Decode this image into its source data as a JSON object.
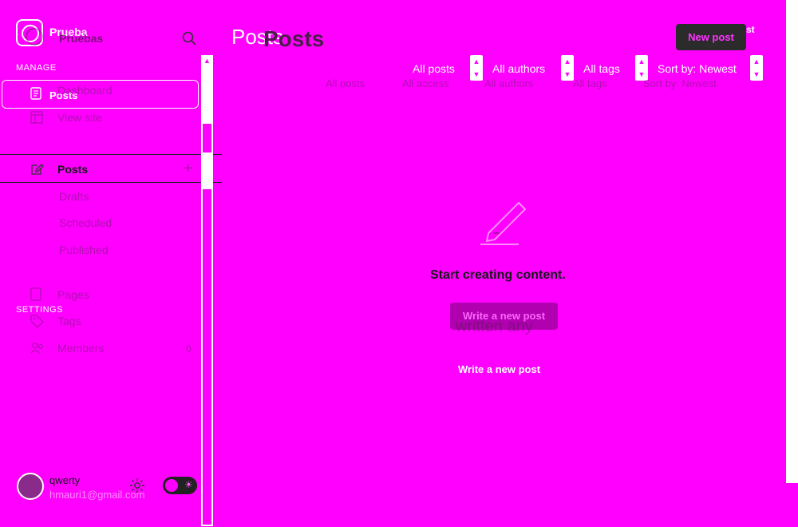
{
  "sidebar": {
    "site_title_front": "Prueba",
    "site_title_back": "Pruebas",
    "manage_label": "MANAGE",
    "settings_label": "SETTINGS",
    "active_overlay_label": "Posts",
    "items": [
      {
        "label": "Dashboard",
        "icon": "dashboard-icon"
      },
      {
        "label": "View site",
        "icon": "view-site-icon"
      },
      {
        "label": "Posts",
        "icon": "edit-icon"
      },
      {
        "label": "Drafts"
      },
      {
        "label": "Scheduled"
      },
      {
        "label": "Published"
      },
      {
        "label": "Pages",
        "icon": "pages-icon"
      },
      {
        "label": "Tags",
        "icon": "tag-icon"
      },
      {
        "label": "Members",
        "icon": "members-icon",
        "count": "0"
      }
    ],
    "user": {
      "name": "qwerty",
      "email": "hmauri1@gmail.com"
    }
  },
  "header": {
    "title_front": "Posts",
    "title_back": "Posts",
    "new_post_label": "New post",
    "new_post_ghost": "st"
  },
  "filters_front": [
    "All posts",
    "All authors",
    "All tags",
    "Sort by: Newest"
  ],
  "filters_back": [
    "All posts",
    "All access",
    "All authors",
    "All tags",
    "Sort by: Newest"
  ],
  "empty_state": {
    "message": "Start creating content.",
    "button_label": "Write a new post",
    "ghost_text": "written any",
    "link_label": "Write a new post"
  },
  "colors": {
    "background": "#ff00ff",
    "button_dark": "#2b2b2b",
    "button_purple": "#b000b0"
  }
}
